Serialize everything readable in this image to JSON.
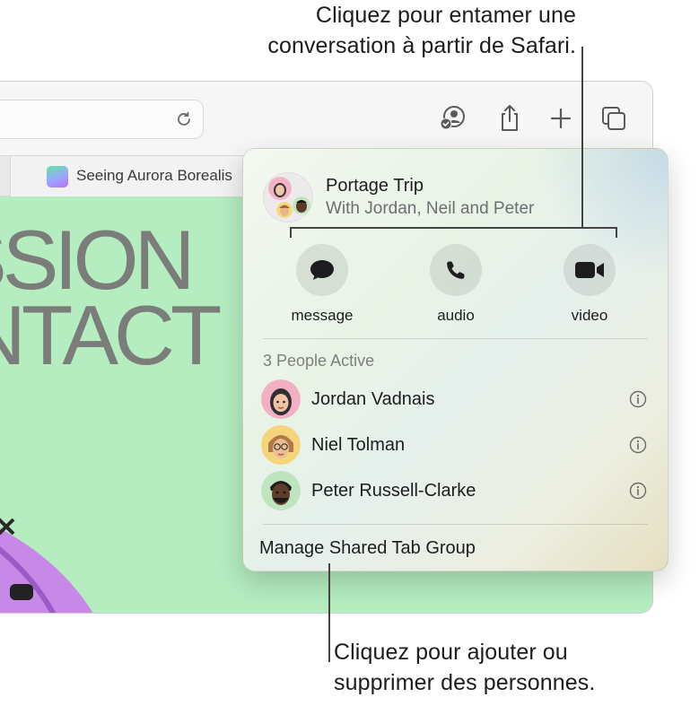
{
  "callouts": {
    "top_line1": "Cliquez pour entamer une",
    "top_line2": "conversation à partir de Safari.",
    "bottom_line1": "Cliquez pour ajouter ou",
    "bottom_line2": "supprimer des personnes."
  },
  "browser": {
    "tab_title": "Seeing Aurora Borealis",
    "hero_line1": "SSION",
    "hero_line2": "NTACT"
  },
  "popover": {
    "group_title": "Portage Trip",
    "group_subtitle": "With Jordan, Neil and Peter",
    "actions": [
      {
        "label": "message",
        "icon": "message-bubble-icon"
      },
      {
        "label": "audio",
        "icon": "phone-icon"
      },
      {
        "label": "video",
        "icon": "video-camera-icon"
      }
    ],
    "section_title": "3 People Active",
    "people": [
      {
        "name": "Jordan Vadnais"
      },
      {
        "name": "Niel Tolman"
      },
      {
        "name": "Peter Russell-Clarke"
      }
    ],
    "manage_label": "Manage Shared Tab Group"
  },
  "colors": {
    "page_background": "#b5ecc0",
    "hero_text": "#7b7d7b"
  }
}
